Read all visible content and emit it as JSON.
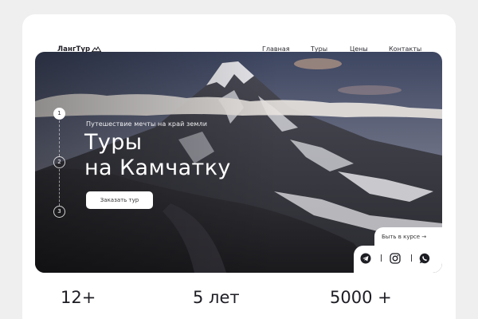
{
  "brand": {
    "name": "ЛангТур"
  },
  "nav": {
    "items": [
      {
        "label": "Главная"
      },
      {
        "label": "Туры"
      },
      {
        "label": "Цены"
      },
      {
        "label": "Контакты"
      }
    ]
  },
  "hero": {
    "subtitle": "Путешествие мечты на край земли",
    "title_line1": "Туры",
    "title_line2": "на Камчатку",
    "cta_label": "Заказать тур",
    "steps": [
      "1",
      "2",
      "3"
    ],
    "active_step": "1",
    "learn_more_label": "Быть в курсе →"
  },
  "social": {
    "icons": [
      "telegram-icon",
      "instagram-icon",
      "whatsapp-icon"
    ]
  },
  "stats": [
    {
      "value": "12+"
    },
    {
      "value": "5 лет"
    },
    {
      "value": "5000 +"
    }
  ],
  "colors": {
    "page_bg": "#efeff0",
    "card_bg": "#ffffff",
    "text_dark": "#1d1d24",
    "button_bg": "#ffffff"
  }
}
